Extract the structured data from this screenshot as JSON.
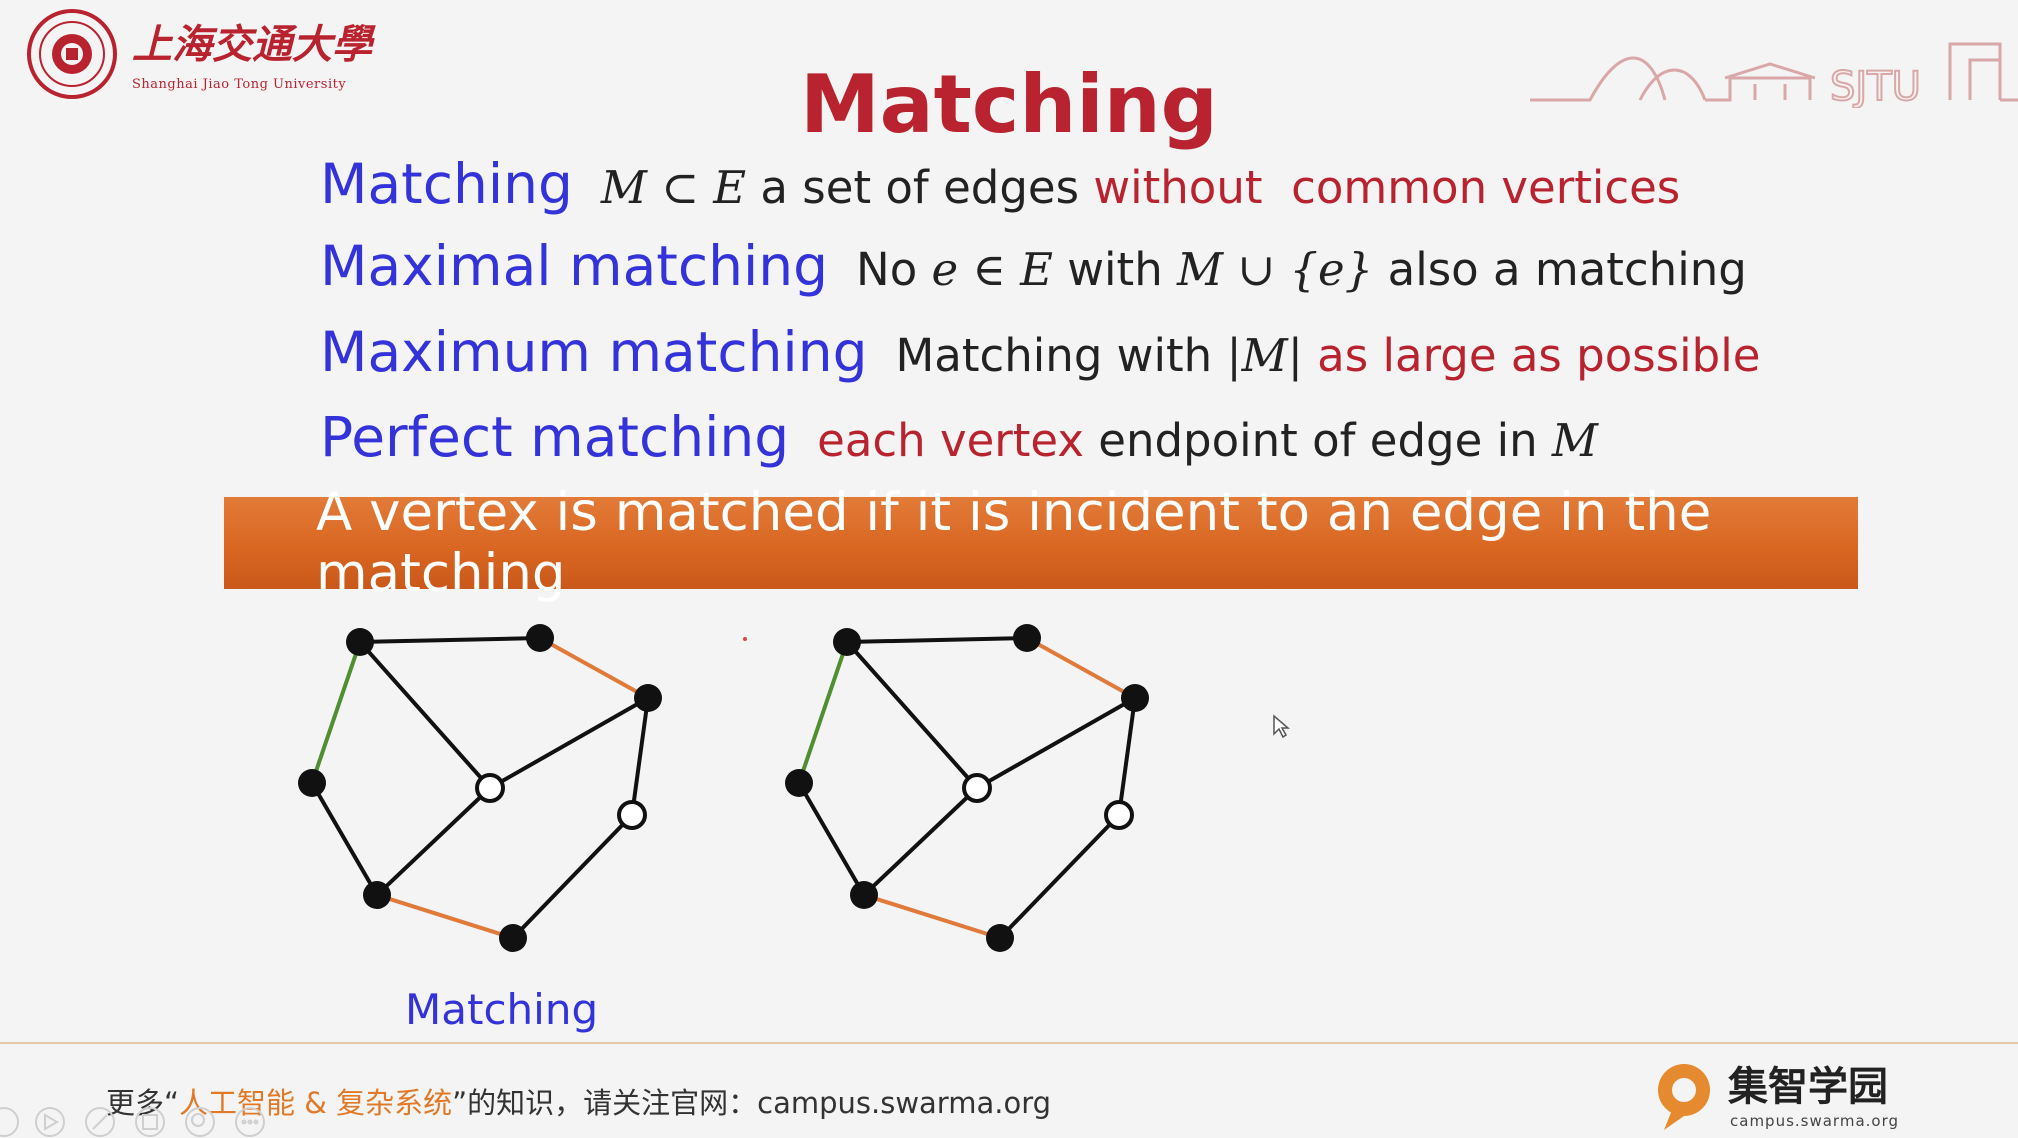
{
  "header": {
    "university_name_cn": "上海交通大學",
    "university_name_en": "Shanghai Jiao Tong University",
    "skyline_label": "SJTU"
  },
  "slide": {
    "title": "Matching",
    "rows": [
      {
        "term": "Matching",
        "math1": "M ⊂ E",
        "text1": " a set of edges ",
        "red1": "without  common vertices"
      },
      {
        "term": "Maximal matching",
        "text0": "No ",
        "math1": "e ∈ E",
        "text1": " with ",
        "math2": "M ∪ {e}",
        "text2": " also a matching"
      },
      {
        "term": "Maximum matching",
        "text0": "Matching with ",
        "math1": "|M|",
        "red1": " as large as possible"
      },
      {
        "term": "Perfect matching",
        "red0": "each vertex",
        "text1": " endpoint of edge in ",
        "math1": "M"
      }
    ],
    "banner": "A vertex is matched if it is incident to an edge in the matching",
    "graph_caption": "Matching"
  },
  "colors": {
    "term_blue": "#3333d9",
    "accent_red": "#b8232f",
    "banner_orange": "#d86520",
    "matched_edge": "#e07a3a",
    "green_edge": "#4f8f2f"
  },
  "footer": {
    "prefix": "更多“",
    "highlight": "人工智能 & 复杂系统",
    "suffix": "”的知识，请关注官网：",
    "url": "campus.swarma.org",
    "brand_cn": "集智学园",
    "brand_url": "campus.swarma.org"
  }
}
